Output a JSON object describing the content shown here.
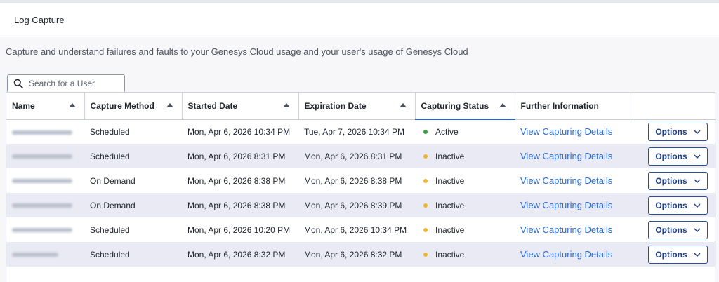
{
  "header": {
    "title": "Log Capture"
  },
  "description": "Capture and understand failures and faults to your Genesys Cloud usage and your user's usage of Genesys Cloud",
  "search": {
    "placeholder": "Search for a User"
  },
  "table": {
    "columns": [
      {
        "label": "Name",
        "sortable": true
      },
      {
        "label": "Capture Method",
        "sortable": true
      },
      {
        "label": "Started Date",
        "sortable": true
      },
      {
        "label": "Expiration Date",
        "sortable": true
      },
      {
        "label": "Capturing Status",
        "sortable": true
      },
      {
        "label": "Further Information",
        "sortable": false
      },
      {
        "label": "",
        "sortable": false
      }
    ],
    "link_label": "View Capturing Details",
    "options_label": "Options",
    "status_colors": {
      "Active": "#3aa13f",
      "Inactive": "#f2b42b"
    },
    "rows": [
      {
        "method": "Scheduled",
        "started": "Mon, Apr 6, 2026 10:34 PM",
        "expiration": "Tue, Apr 7, 2026 10:34 PM",
        "status": "Active"
      },
      {
        "method": "Scheduled",
        "started": "Mon, Apr 6, 2026 8:31 PM",
        "expiration": "Mon, Apr 6, 2026 8:31 PM",
        "status": "Inactive"
      },
      {
        "method": "On Demand",
        "started": "Mon, Apr 6, 2026 8:38 PM",
        "expiration": "Mon, Apr 6, 2026 8:38 PM",
        "status": "Inactive"
      },
      {
        "method": "On Demand",
        "started": "Mon, Apr 6, 2026 8:38 PM",
        "expiration": "Mon, Apr 6, 2026 8:39 PM",
        "status": "Inactive"
      },
      {
        "method": "Scheduled",
        "started": "Mon, Apr 6, 2026 10:20 PM",
        "expiration": "Mon, Apr 6, 2026 10:34 PM",
        "status": "Inactive"
      },
      {
        "method": "Scheduled",
        "started": "Mon, Apr 6, 2026 8:32 PM",
        "expiration": "Mon, Apr 6, 2026 8:32 PM",
        "status": "Inactive"
      }
    ]
  }
}
